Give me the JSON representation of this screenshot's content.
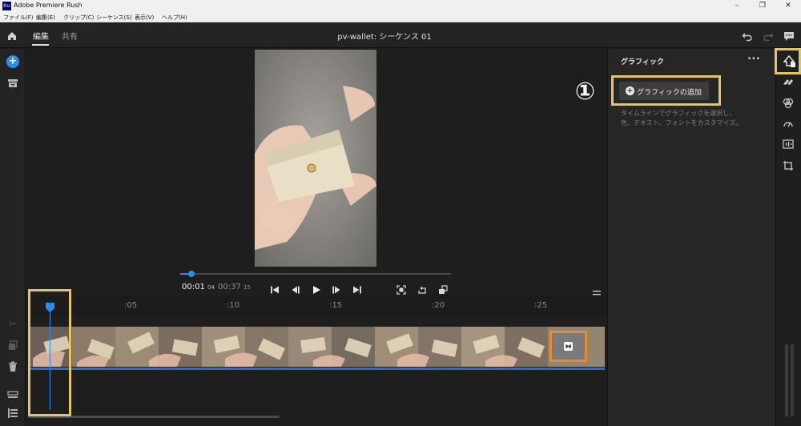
{
  "window": {
    "title": "Adobe Premiere Rush",
    "app_badge": "Ru",
    "controls": [
      "–",
      "❐",
      "✕"
    ]
  },
  "menu": [
    "ファイル(F)",
    "編集(E)",
    "クリップ(C)",
    "シーケンス(S)",
    "表示(V)",
    "ヘルプ(H)"
  ],
  "header": {
    "tabs": [
      {
        "label": "編集",
        "active": true
      },
      {
        "label": "共有",
        "active": false
      }
    ],
    "sequence_title": "pv-wallet: シーケンス 01"
  },
  "panel": {
    "title": "グラフィック",
    "more": "•••",
    "add_button": "グラフィックの追加",
    "help_line1": "タイムラインでグラフィックを選択し、",
    "help_line2": "色、テキスト、フォントをカスタマイズ。"
  },
  "annotation": {
    "step": "①"
  },
  "playback": {
    "current_main": "00:01",
    "current_frames": "04",
    "duration_main": "00:37",
    "duration_frames": "15",
    "scrub_position": 0.04
  },
  "ruler": [
    ":05",
    ":10",
    ":15",
    ":20",
    ":25"
  ],
  "colors": {
    "highlight": "#e6c463",
    "accent": "#2d8ceb",
    "selected_clip": "#e98a2c"
  }
}
